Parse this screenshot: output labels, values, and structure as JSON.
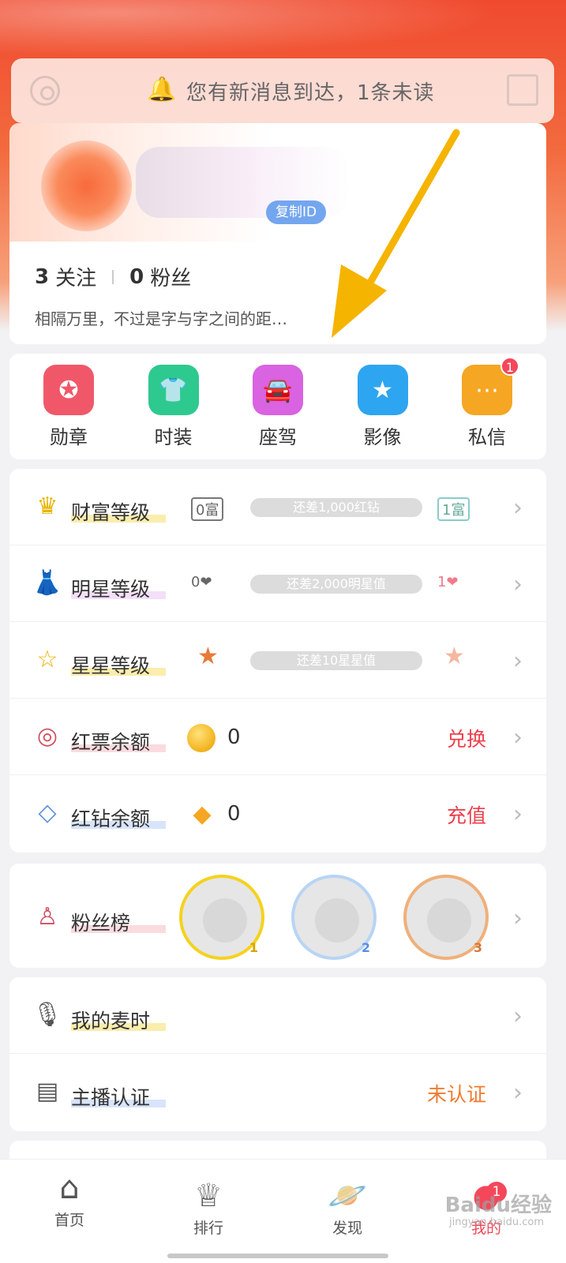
{
  "notice": {
    "message": "您有新消息到达，1条未读"
  },
  "profile": {
    "copy_id_label": "复制ID",
    "following_count": "3",
    "following_label": "关注",
    "fans_count": "0",
    "fans_label": "粉丝",
    "signature": "相隔万里，不过是字与字之间的距…"
  },
  "quick_menu": [
    {
      "label": "勋章",
      "icon": "medal-icon",
      "color": "#f0586a"
    },
    {
      "label": "时装",
      "icon": "shirt-icon",
      "color": "#2ec98f"
    },
    {
      "label": "座驾",
      "icon": "car-icon",
      "color": "#d963e0"
    },
    {
      "label": "影像",
      "icon": "star-icon",
      "color": "#2ea5f0"
    },
    {
      "label": "私信",
      "icon": "chat-icon",
      "color": "#f5a623",
      "badge": "1"
    }
  ],
  "levels": {
    "wealth": {
      "label": "财富等级",
      "from": "0富",
      "progress_text": "还差1,000红钻",
      "to": "1富"
    },
    "star": {
      "label": "明星等级",
      "from": "0",
      "progress_text": "还差2,000明星值",
      "to": "1"
    },
    "stars": {
      "label": "星星等级",
      "progress_text": "还差10星星值"
    },
    "redticket": {
      "label": "红票余额",
      "value": "0",
      "action": "兑换"
    },
    "reddiamond": {
      "label": "红钻余额",
      "value": "0",
      "action": "充值"
    }
  },
  "fans_board": {
    "label": "粉丝榜",
    "ranks": [
      "1",
      "2",
      "3"
    ]
  },
  "misc": {
    "mic_time_label": "我的麦时",
    "anchor_label": "主播认证",
    "anchor_status": "未认证"
  },
  "tabs": [
    {
      "label": "首页",
      "icon": "home-icon"
    },
    {
      "label": "排行",
      "icon": "crown-icon"
    },
    {
      "label": "发现",
      "icon": "planet-icon"
    },
    {
      "label": "我的",
      "icon": "profile-icon",
      "badge": "1"
    }
  ],
  "watermark": {
    "text": "Baidu经验",
    "sub": "jingyan.baidu.com"
  },
  "colors": {
    "accent": "#f5475a",
    "header": "#f04a2e",
    "action": "#ee3f4d",
    "pending": "#f07a2e"
  }
}
